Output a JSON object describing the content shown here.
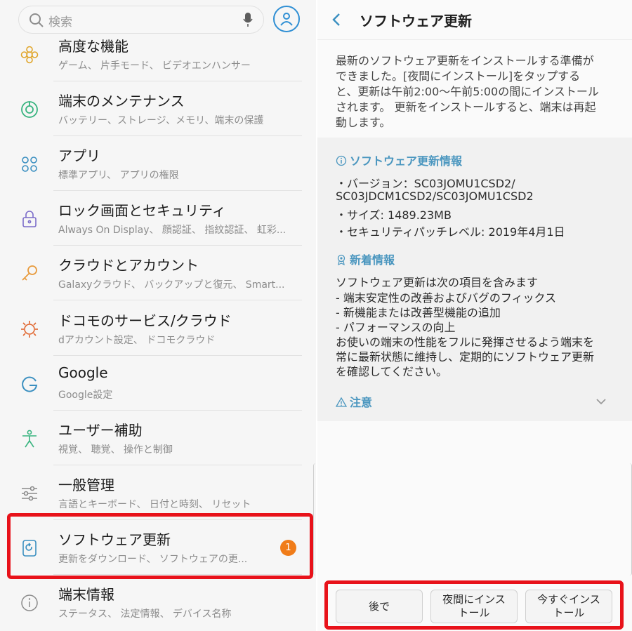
{
  "search": {
    "placeholder": "検索"
  },
  "settings": [
    {
      "title": "高度な機能",
      "sub": "ゲーム、 片手モード、 ビデオエンハンサー",
      "icon": "advanced-features-icon"
    },
    {
      "title": "端末のメンテナンス",
      "sub": "バッテリー、ストレージ、メモリ、端末の保護",
      "icon": "device-maintenance-icon"
    },
    {
      "title": "アプリ",
      "sub": "標準アプリ、 アプリの権限",
      "icon": "apps-icon"
    },
    {
      "title": "ロック画面とセキュリティ",
      "sub": "Always On Display、 顔認証、 指紋認証、 虹彩...",
      "icon": "lock-icon"
    },
    {
      "title": "クラウドとアカウント",
      "sub": "Galaxyクラウド、 バックアップと復元、 Smart...",
      "icon": "key-icon"
    },
    {
      "title": "ドコモのサービス/クラウド",
      "sub": "dアカウント設定、 ドコモクラウド",
      "icon": "docomo-icon"
    },
    {
      "title": "Google",
      "sub": "Google設定",
      "icon": "google-icon"
    },
    {
      "title": "ユーザー補助",
      "sub": "視覚、 聴覚、 操作と制御",
      "icon": "accessibility-icon"
    },
    {
      "title": "一般管理",
      "sub": "言語とキーボード、 日付と時刻、 リセット",
      "icon": "sliders-icon"
    },
    {
      "title": "ソフトウェア更新",
      "sub": "更新をダウンロード、 ソフトウェアの更...",
      "icon": "software-update-icon",
      "badge": "1"
    },
    {
      "title": "端末情報",
      "sub": "ステータス、 法定情報、 デバイス名称",
      "icon": "info-icon"
    }
  ],
  "detail": {
    "title": "ソフトウェア更新",
    "intro_lines": [
      "最新のソフトウェア更新をインストールする準備が",
      "できました。[夜間にインストール]をタップする",
      "と、更新は午前2:00〜午前5:00の間にインストール",
      "されます。 更新をインストールすると、端末は再起",
      "動します。"
    ],
    "info_heading": "ソフトウェア更新情報",
    "info_lines": [
      "・バージョン：SC03JOMU1CSD2/",
      "SC03JDCM1CSD2/SC03JOMU1CSD2",
      "・サイズ: 1489.23MB",
      "・セキュリティパッチレベル: 2019年4月1日"
    ],
    "new_heading": "新着情報",
    "new_lines": [
      "ソフトウェア更新は次の項目を含みます",
      "- 端末安定性の改善およびバグのフィックス",
      "- 新機能または改善型機能の追加",
      "- パフォーマンスの向上",
      "お使いの端末の性能をフルに発揮させるよう端末を",
      "常に最新状態に維持し、定期的にソフトウェア更新",
      "を確認してください。"
    ],
    "caution_heading": "注意"
  },
  "buttons": {
    "later": "後で",
    "night_line1": "夜間にインス",
    "night_line2": "トール",
    "now_line1": "今すぐインス",
    "now_line2": "トール"
  },
  "colors": {
    "accent": "#4a96bf",
    "highlight": "#e8121a",
    "badge": "#f07c19"
  }
}
